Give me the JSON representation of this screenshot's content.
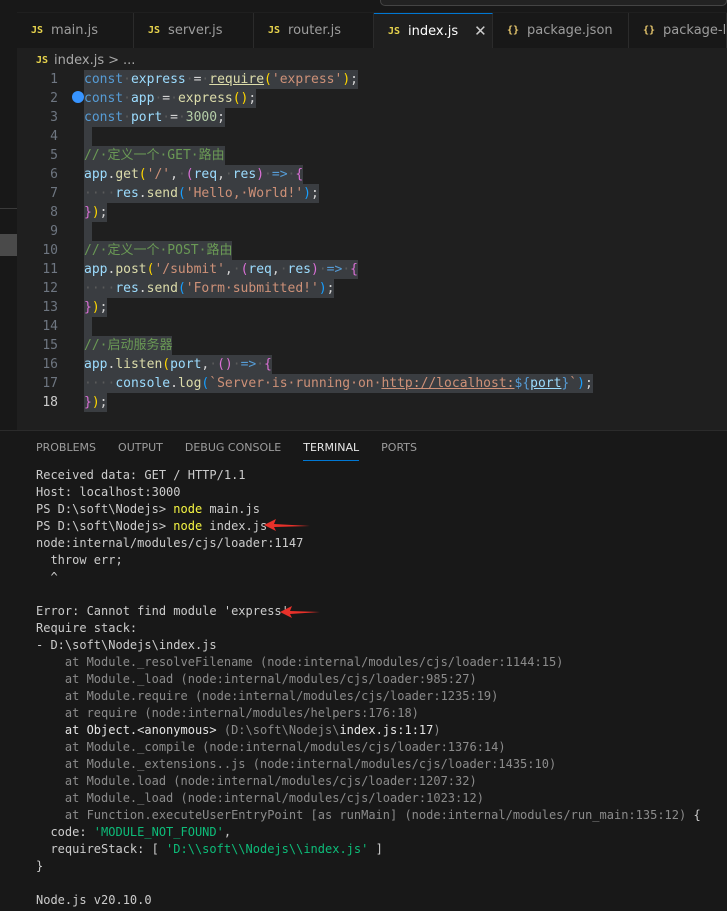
{
  "tabs": [
    {
      "label": "main.js",
      "icon": "js-icon",
      "active": false
    },
    {
      "label": "server.js",
      "icon": "js-icon",
      "active": false
    },
    {
      "label": "router.js",
      "icon": "js-icon",
      "active": false
    },
    {
      "label": "index.js",
      "icon": "js-icon",
      "active": true
    },
    {
      "label": "package.json",
      "icon": "json-braces-icon",
      "active": false
    },
    {
      "label": "package-lo",
      "icon": "json-braces-icon",
      "active": false
    }
  ],
  "tab_icons": {
    "js": "JS",
    "json": "{}"
  },
  "close_glyph": "✕",
  "breadcrumb": {
    "file": "index.js",
    "sep": ">",
    "more": "..."
  },
  "editor": {
    "current_line": 18,
    "line_numbers": [
      "1",
      "2",
      "3",
      "4",
      "5",
      "6",
      "7",
      "8",
      "9",
      "10",
      "11",
      "12",
      "13",
      "14",
      "15",
      "16",
      "17",
      "18"
    ],
    "lines": [
      "const express = require('express');",
      "const app = express();",
      "const port = 3000;",
      "",
      "// 定义一个 GET 路由",
      "app.get('/', (req, res) => {",
      "  res.send('Hello, World!');",
      "});",
      "",
      "// 定义一个 POST 路由",
      "app.post('/submit', (req, res) => {",
      "  res.send('Form submitted!');",
      "});",
      "",
      "// 启动服务器",
      "app.listen(port, () => {",
      "  console.log(`Server is running on http://localhost:${port}`);",
      "});"
    ]
  },
  "panel": {
    "tabs": [
      "PROBLEMS",
      "OUTPUT",
      "DEBUG CONSOLE",
      "TERMINAL",
      "PORTS"
    ],
    "active_tab": "TERMINAL"
  },
  "terminal": {
    "lines": [
      "Received data: GET / HTTP/1.1",
      "Host: localhost:3000",
      "PS D:\\soft\\Nodejs> node main.js",
      "PS D:\\soft\\Nodejs> node index.js",
      "node:internal/modules/cjs/loader:1147",
      "  throw err;",
      "  ^",
      "",
      "Error: Cannot find module 'express'",
      "Require stack:",
      "- D:\\soft\\Nodejs\\index.js",
      "    at Module._resolveFilename (node:internal/modules/cjs/loader:1144:15)",
      "    at Module._load (node:internal/modules/cjs/loader:985:27)",
      "    at Module.require (node:internal/modules/cjs/loader:1235:19)",
      "    at require (node:internal/modules/helpers:176:18)",
      "    at Object.<anonymous> (D:\\soft\\Nodejs\\index.js:1:17)",
      "    at Module._compile (node:internal/modules/cjs/loader:1376:14)",
      "    at Module._extensions..js (node:internal/modules/cjs/loader:1435:10)",
      "    at Module.load (node:internal/modules/cjs/loader:1207:32)",
      "    at Module._load (node:internal/modules/cjs/loader:1023:12)",
      "    at Function.executeUserEntryPoint [as runMain] (node:internal/modules/run_main:135:12) {",
      "  code: 'MODULE_NOT_FOUND',",
      "  requireStack: [ 'D:\\\\soft\\\\Nodejs\\\\index.js' ]",
      "}",
      "",
      "Node.js v20.10.0"
    ]
  },
  "annotation_color": "#e8312a"
}
